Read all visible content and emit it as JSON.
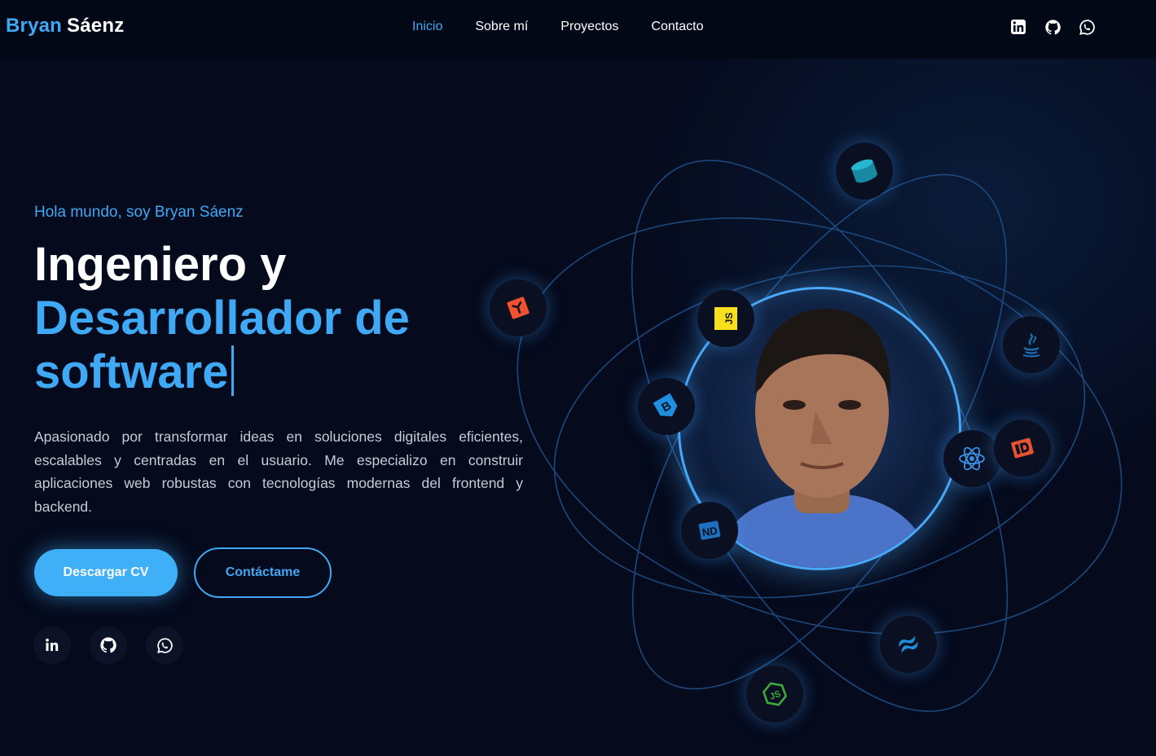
{
  "header": {
    "brand_first": "Bryan",
    "brand_last": "Sáenz",
    "nav": [
      {
        "label": "Inicio",
        "active": true
      },
      {
        "label": "Sobre mí",
        "active": false
      },
      {
        "label": "Proyectos",
        "active": false
      },
      {
        "label": "Contacto",
        "active": false
      }
    ],
    "social_icons": [
      "linkedin-icon",
      "github-icon",
      "whatsapp-icon"
    ]
  },
  "hero": {
    "greeting": "Hola mundo, soy Bryan Sáenz",
    "headline_line1": "Ingeniero y",
    "headline_line2": "Desarrollador de",
    "headline_line3": "software",
    "description": "Apasionado por transformar ideas en soluciones digitales eficientes, escalables y centradas en el usuario. Me especializo en construir aplicaciones web robustas con tecnologías modernas del frontend y backend.",
    "primary_button": "Descargar CV",
    "secondary_button": "Contáctame",
    "social_buttons": [
      "linkedin-icon",
      "github-icon",
      "whatsapp-icon"
    ]
  },
  "visual": {
    "avatar": "profile-photo",
    "tech_icons": [
      "sql-icon",
      "laravel-icon",
      "javascript-icon",
      "java-icon",
      "bootstrap-icon",
      "react-icon",
      "livewire-icon",
      "nestjs-icon",
      "tailwind-icon",
      "nodejs-icon"
    ]
  },
  "colors": {
    "background": "#050a1c",
    "accent": "#3fa9f5",
    "text": "#ffffff",
    "muted_text": "#c7ccd6"
  }
}
